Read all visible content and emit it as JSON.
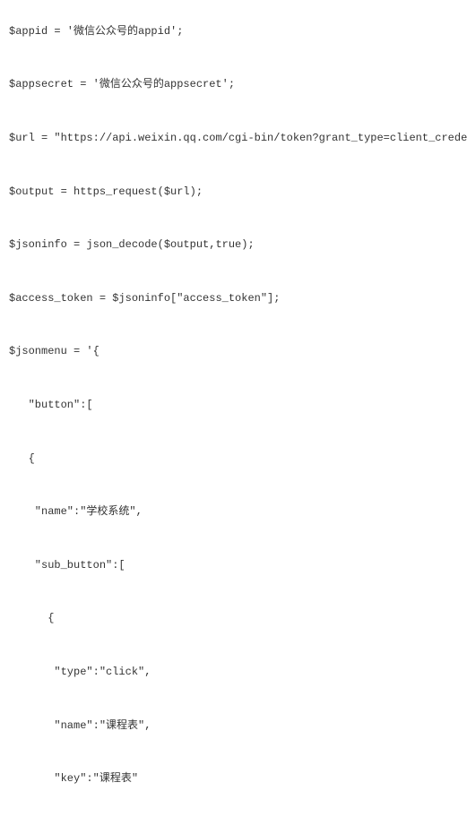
{
  "code": {
    "lines": [
      "$appid = '微信公众号的appid';",
      "$appsecret = '微信公众号的appsecret';",
      "$url = \"https://api.weixin.qq.com/cgi-bin/token?grant_type=client_credenti",
      "$output = https_request($url);",
      "$jsoninfo = json_decode($output,true);",
      "$access_token = $jsoninfo[\"access_token\"];",
      "$jsonmenu = '{",
      "   \"button\":[",
      "   {",
      "    \"name\":\"学校系统\",",
      "    \"sub_button\":[",
      "      {",
      "       \"type\":\"click\",",
      "       \"name\":\"课程表\",",
      "       \"key\":\"课程表\""
    ]
  }
}
